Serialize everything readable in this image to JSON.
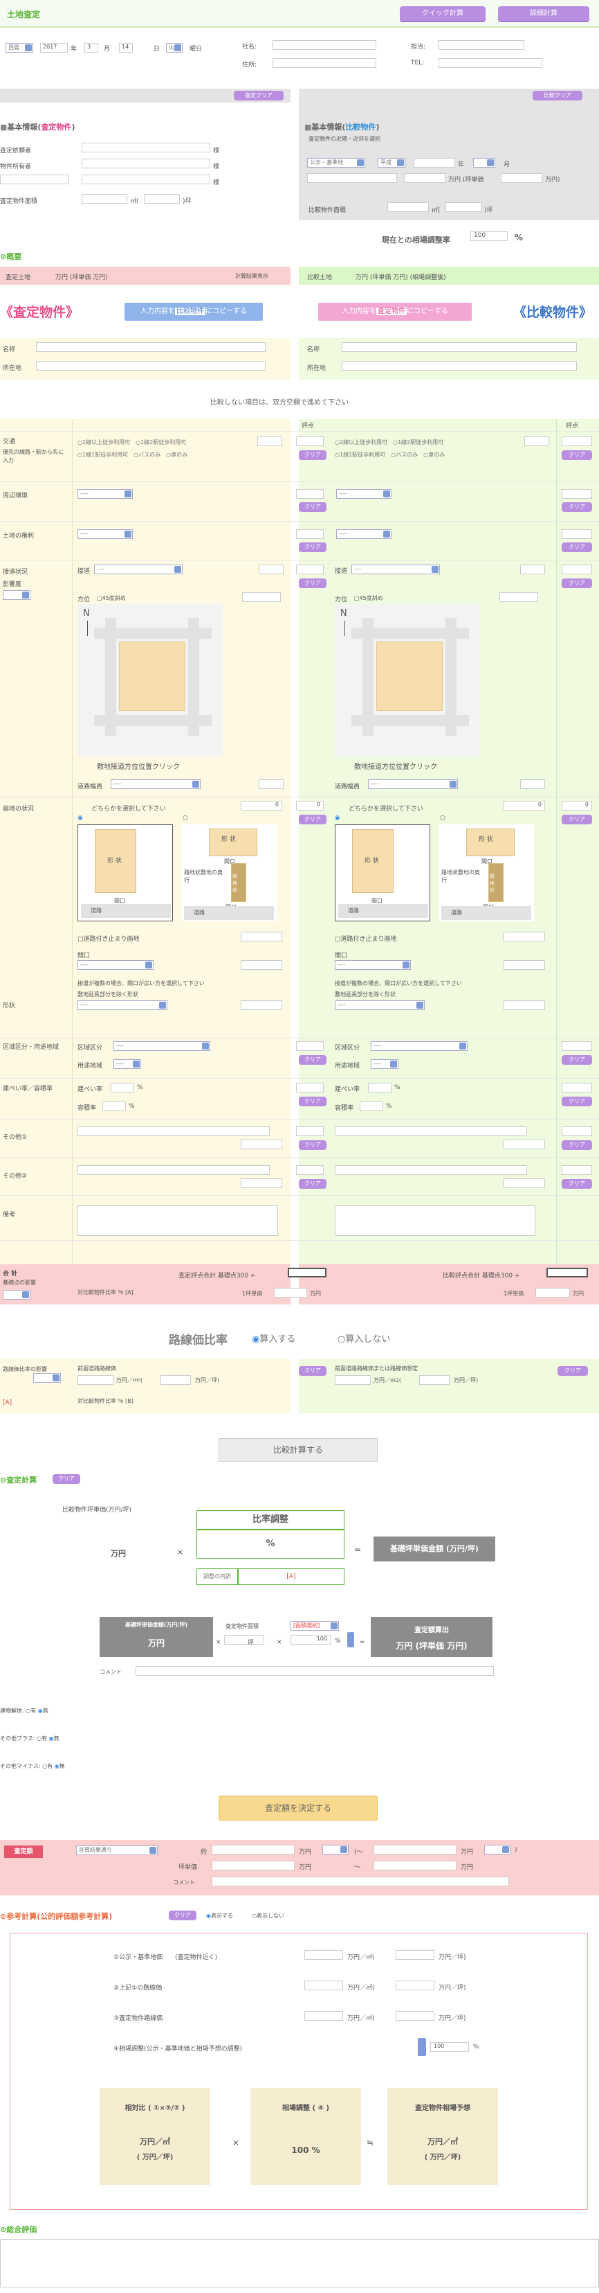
{
  "header": {
    "title": "土地査定",
    "quick_btn": "クイック計算",
    "detail_btn": "詳細計算"
  },
  "meta": {
    "era": "西暦",
    "year": "2017",
    "year_u": "年",
    "month": "3",
    "month_u": "月",
    "day": "14",
    "day_u": "日",
    "weekday": "火",
    "weekday_u": "曜日",
    "company": "社名:",
    "staff": "担当:",
    "address": "住所:",
    "tel": "TEL:"
  },
  "appraisal_clear": "査定クリア",
  "compare_clear": "比較クリア",
  "left_info": {
    "title_pre": "基本情報(",
    "title_em": "査定物件",
    "title_post": ")",
    "requester": "査定依頼者",
    "owner": "物件所有者",
    "area": "査定物件面積",
    "sama": "様",
    "m2": "㎡(",
    "tsubo": ")坪"
  },
  "right_info": {
    "title_pre": "基本情報(",
    "title_em": "比較物件",
    "title_post": ")",
    "sub": "査定物件の近隣・近郊を選択",
    "sel1": "公示・基準地",
    "sel2": "平成",
    "year_u": "年",
    "month_u": "月",
    "man_tsubo": "万円 (坪単価",
    "man": "万円)",
    "area": "比較物件面積",
    "m2": "㎡(",
    "tsubo": ")坪"
  },
  "adjust_rate": {
    "label": "現在との相場調整率",
    "value": "100",
    "unit": "%"
  },
  "summary": {
    "title": "概要",
    "left_bar": "査定土地",
    "left_unit": "万円 (坪単価  万円)",
    "left_note": "計算結果表示",
    "right_bar": "比較土地",
    "right_unit": "万円 (坪単価  万円) (相場調整後)"
  },
  "banner": {
    "left": "《査定物件》",
    "copy_l_a": "入力内容を",
    "copy_l_em": "比較物件",
    "copy_l_b": "にコピーする",
    "copy_r_a": "入力内容を",
    "copy_r_em": "査定物件",
    "copy_r_b": "にコピーする",
    "right": "《比較物件》"
  },
  "names": {
    "name": "名称",
    "location": "所在地"
  },
  "note": "比較しない項目は、双方空欄で進めて下さい",
  "score": "評点",
  "clear": "クリア",
  "rows": {
    "traffic": "交通",
    "traffic_note": "優先の線路・駅から先に入力",
    "traffic_opts": [
      "2線以上徒歩利用可",
      "1線2駅徒歩利用可",
      "1線1駅徒歩利用可",
      "バスのみ",
      "車のみ"
    ],
    "env": "周辺環境",
    "rights": "土地の権利",
    "access": "接道状況",
    "access_sub": "影響度",
    "side": "接道",
    "dir": "方位",
    "deg": "45度斜め",
    "map_caption": "敷地接道方位位置クリック",
    "road_width": "道路幅員",
    "shape_title": "画地の状況",
    "shape_choose": "どちらかを選択して下さい",
    "shape_a": "形 状",
    "shape_b": "形 状",
    "frontage": "間口",
    "road": "道路",
    "flag_body": "路地状敷地の奥行",
    "flag_path": "路地状",
    "depth_check": "道路付き止まり画地",
    "frontage_lbl": "間口",
    "multi_note": "接道が複数の場合、間口が広い方を選択して下さい",
    "irreg": "形状",
    "irreg_note": "敷地延長部分を除く形状",
    "zone": "区域区分・用途地域",
    "zone_a": "区域区分",
    "zone_b": "用途地域",
    "ratio": "建ぺい率／容積率",
    "ratio_a": "建ぺい率",
    "ratio_b": "容積率",
    "other1": "その他①",
    "other2": "その他②",
    "remarks": "備考",
    "total": "合 計",
    "total_sub": "基礎点の影響",
    "total_note": "査定評点合計 基礎点300 +",
    "total_right": "比較評点合計 基礎点300 +",
    "ratio_pct": "対比較物件比率 ％ [A]",
    "unit_price": "1坪単価",
    "man": "万円",
    "dash": "----",
    "zero": "0"
  },
  "road_ratio": {
    "title": "路線価比率",
    "opt1": "算入する",
    "opt2": "算入しない",
    "label": "路線価比率の影響",
    "tag": "[A]",
    "left_a": "前面道路路線価",
    "unit_a": "万円／m²(",
    "unit_b": "万円／坪)",
    "right_a": "前面道路路線価または路線価想定",
    "unit_c": "万円／m2(",
    "unit_d": "万円／坪)",
    "pct": "対比較物件比率 ％ [B]"
  },
  "compare_btn": "比較計算する",
  "calc": {
    "title": "査定計算",
    "clear": "クリア",
    "unit_label": "比較物件坪単価(万円/坪)",
    "man": "万円",
    "times": "×",
    "adj_title": "比率調整",
    "pct": "%",
    "eq": "=",
    "base": "基礎坪単価金額 (万円/坪)",
    "breakdown": "調整の内訳",
    "breakdown_a": "[A]",
    "base2": "基礎坪単価金額(万円/坪)",
    "area": "査定物件面積",
    "area_sel": "[面積選択]",
    "man2": "万円",
    "tsubo": "坪",
    "hundred": "100",
    "pct2": "%",
    "result": "査定額算出",
    "result2": "万円 (坪単価  万円)",
    "comment": "コメント"
  },
  "plus_minus": {
    "building": "建物解体:",
    "plus": "その他プラス:",
    "minus": "その他マイナス:",
    "yes": "有",
    "no": "無"
  },
  "decide_btn": "査定額を決定する",
  "result": {
    "badge": "査定額",
    "select": "計算結果通り",
    "approx": "約",
    "man": "万円",
    "low": "(～",
    "tsubo_price": "坪単価",
    "tilde": "～",
    "end": ")",
    "comment": "コメント"
  },
  "ref": {
    "title": "参考計算(公的評価額参考計算)",
    "clear": "クリア",
    "show": "表示する",
    "hide": "表示しない",
    "items": [
      "①公示・基準地価　　(査定物件近く)",
      "②上記①の路線価",
      "③査定物件路線価",
      "④相場調整(公示・基準地価と相場予想の調整)"
    ],
    "unit": "万円／㎡(",
    "unit2": "万円／坪)",
    "adj": "100",
    "pct": "%",
    "box1": "相対比 ( ①×③/② )",
    "box2": "相場調整 ( ④ )",
    "box3": "査定物件相場予想",
    "box1v": "万円／㎡",
    "box1v2": "( 万円／坪)",
    "times": "×",
    "box2v": "100 %",
    "approx": "≒",
    "box3v": "万円／㎡",
    "box3v2": "( 万円／坪)"
  },
  "overall": "総合評価"
}
